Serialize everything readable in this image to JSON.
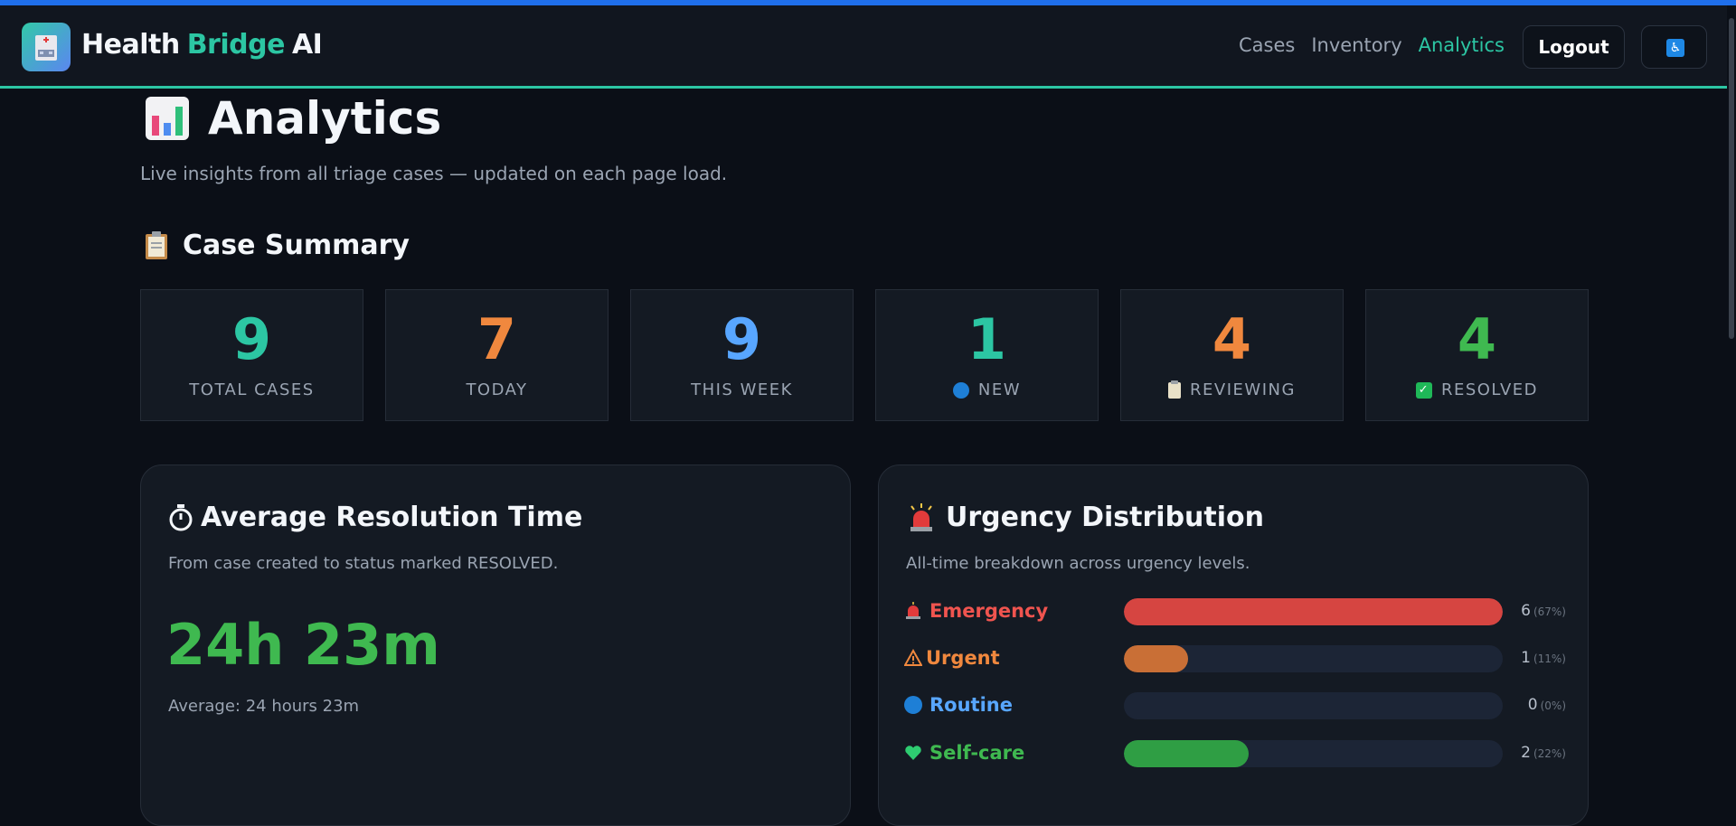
{
  "header": {
    "brand_part1": "Health",
    "brand_part2": "Bridge",
    "brand_part3": "AI",
    "nav": [
      {
        "label": "Cases",
        "active": false
      },
      {
        "label": "Inventory",
        "active": false
      },
      {
        "label": "Analytics",
        "active": true
      }
    ],
    "logout_label": "Logout",
    "accessibility_icon": "wheelchair-icon"
  },
  "page": {
    "title": "Analytics",
    "subtitle": "Live insights from all triage cases — updated on each page load.",
    "summary_title": "Case Summary"
  },
  "stats": [
    {
      "value": "9",
      "label": "TOTAL CASES",
      "color": "#2cc6a3",
      "icon": ""
    },
    {
      "value": "7",
      "label": "TODAY",
      "color": "#f0883e",
      "icon": ""
    },
    {
      "value": "9",
      "label": "THIS WEEK",
      "color": "#58a6ff",
      "icon": ""
    },
    {
      "value": "1",
      "label": "NEW",
      "color": "#2cc6a3",
      "icon": "blue-circle-icon"
    },
    {
      "value": "4",
      "label": "REVIEWING",
      "color": "#f0883e",
      "icon": "clipboard-icon"
    },
    {
      "value": "4",
      "label": "RESOLVED",
      "color": "#3fb950",
      "icon": "check-icon"
    }
  ],
  "resolution": {
    "title": "Average Resolution Time",
    "description": "From case created to status marked RESOLVED.",
    "value": "24h 23m",
    "note": "Average: 24 hours 23m"
  },
  "urgency": {
    "title": "Urgency Distribution",
    "description": "All-time breakdown across urgency levels.",
    "levels": [
      {
        "label": "Emergency",
        "count": "6",
        "pct": "(67%)",
        "fraction": 1.0,
        "color": "#f0544f",
        "bar": "#d64541",
        "icon": "siren-icon"
      },
      {
        "label": "Urgent",
        "count": "1",
        "pct": "(11%)",
        "fraction": 0.17,
        "color": "#f0883e",
        "bar": "#c96f36",
        "icon": "warning-icon"
      },
      {
        "label": "Routine",
        "count": "0",
        "pct": "(0%)",
        "fraction": 0.0,
        "color": "#58a6ff",
        "bar": "#1e7fd6",
        "icon": "blue-circle-icon"
      },
      {
        "label": "Self-care",
        "count": "2",
        "pct": "(22%)",
        "fraction": 0.33,
        "color": "#3fb950",
        "bar": "#2f9e44",
        "icon": "heart-icon"
      }
    ]
  }
}
